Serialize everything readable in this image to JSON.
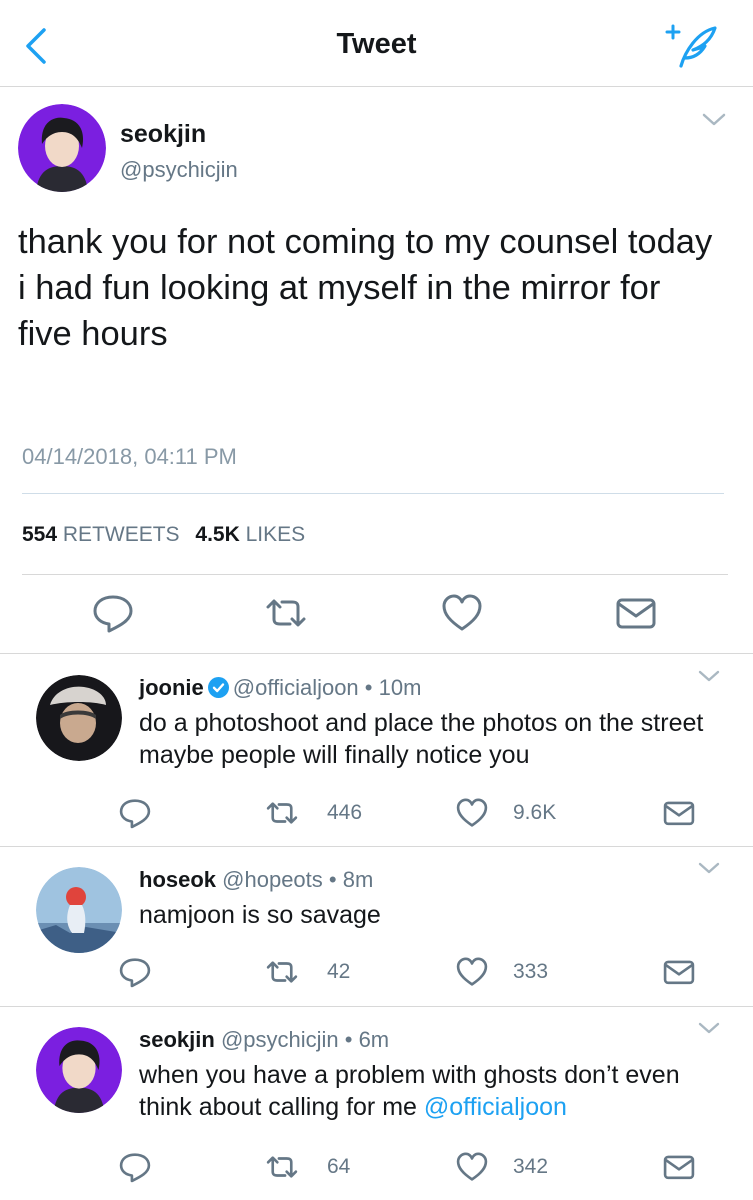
{
  "nav": {
    "title": "Tweet"
  },
  "main_tweet": {
    "name": "seokjin",
    "handle": "@psychicjin",
    "text": "thank you for not coming to my counsel today i had fun looking at myself in the mirror for five hours",
    "date": "04/14/2018, 04:11 PM",
    "retweets_count": "554",
    "retweets_label": "RETWEETS",
    "likes_count": "4.5K",
    "likes_label": "LIKES"
  },
  "replies": [
    {
      "name": "joonie",
      "verified": true,
      "handle": "@officialjoon",
      "time": " • 10m",
      "text": "do a photoshoot and place the photos on the street maybe people will finally notice you",
      "retweets": "446",
      "likes": "9.6K"
    },
    {
      "name": "hoseok",
      "verified": false,
      "handle": "@hopeots",
      "time": " • 8m",
      "text": "namjoon is so savage",
      "retweets": "42",
      "likes": "333"
    },
    {
      "name": "seokjin",
      "verified": false,
      "handle": "@psychicjin",
      "time": " • 6m",
      "text": "when you have a problem with ghosts don’t even think about calling for me ",
      "mention": "@officialjoon",
      "retweets": "64",
      "likes": "342"
    }
  ],
  "icons": {
    "back": "chevron-left-icon",
    "compose": "compose-feather-icon",
    "reply": "reply-bubble-icon",
    "retweet": "retweet-icon",
    "like": "heart-icon",
    "share": "envelope-icon",
    "caret": "chevron-down-icon",
    "verified": "verified-badge-icon"
  },
  "colors": {
    "accent": "#1da1f2",
    "text": "#14171a",
    "secondary": "#657786",
    "avatar_bg": "#7b1fe0"
  }
}
